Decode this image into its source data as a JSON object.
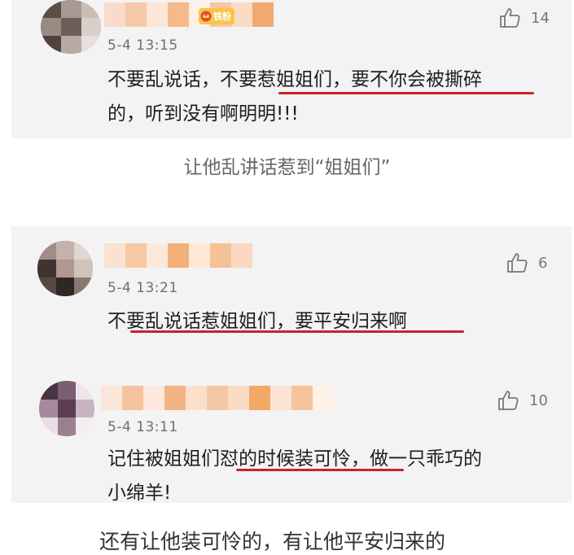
{
  "comments": [
    {
      "time": "5-4 13:15",
      "badge": "铁粉",
      "likes": "14",
      "lines": [
        "不要乱说话，不要惹姐姐们，要不你会被撕碎",
        "的，听到没有啊明明!!!"
      ]
    },
    {
      "time": "5-4 13:21",
      "likes": "6",
      "lines": [
        "不要乱说话惹姐姐们，要平安归来啊"
      ]
    },
    {
      "time": "5-4 13:11",
      "likes": "10",
      "lines": [
        "记住被姐姐们怼的时候装可怜，做一只乖巧的",
        "小绵羊!"
      ]
    }
  ],
  "captions": {
    "first": "让他乱讲话惹到“姐姐们”",
    "bottom": "还有让他装可怜的，有让他平安归来的"
  },
  "colors": {
    "underline": "#c8222f",
    "card_bg": "#f3f3f3",
    "badge": "#f7c54a"
  },
  "icons": {
    "like": "thumbs-up-icon"
  }
}
